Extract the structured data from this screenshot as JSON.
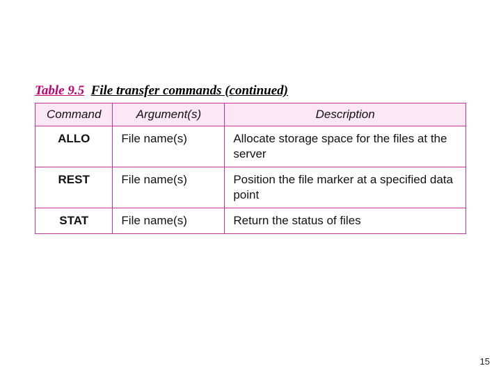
{
  "caption": {
    "table_ref": "Table 9.5",
    "title": "File transfer commands (continued)"
  },
  "table": {
    "headers": {
      "command": "Command",
      "arguments": "Argument(s)",
      "description": "Description"
    },
    "rows": [
      {
        "command": "ALLO",
        "arguments": "File name(s)",
        "description": "Allocate storage space for the files at the server"
      },
      {
        "command": "REST",
        "arguments": "File name(s)",
        "description": "Position the file marker at a specified data point"
      },
      {
        "command": "STAT",
        "arguments": "File name(s)",
        "description": "Return the status of files"
      }
    ]
  },
  "page_number": "15"
}
